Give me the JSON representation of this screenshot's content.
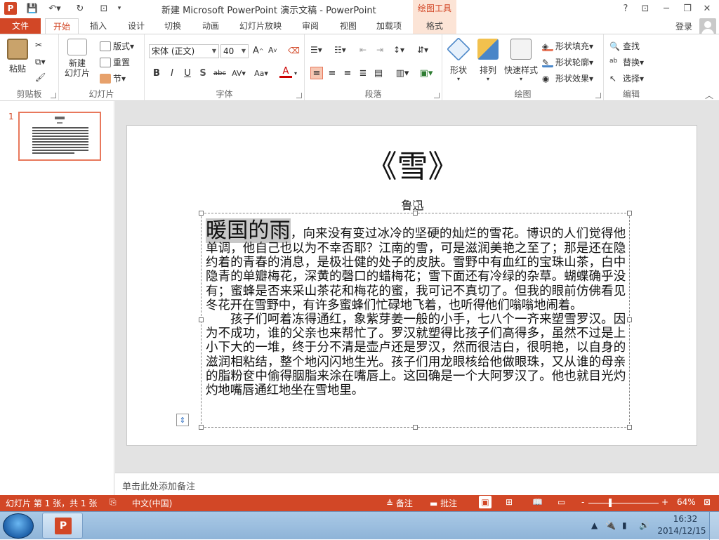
{
  "title_bar": {
    "window_title": "新建 Microsoft PowerPoint 演示文稿 - PowerPoint",
    "app_logo": "P",
    "contextual_tab_group": "绘图工具",
    "help": "?"
  },
  "tabs": {
    "file": "文件",
    "items": [
      "开始",
      "插入",
      "设计",
      "切换",
      "动画",
      "幻灯片放映",
      "审阅",
      "视图",
      "加载项",
      "格式"
    ],
    "active": "开始",
    "login": "登录"
  },
  "ribbon": {
    "clipboard": {
      "label": "剪贴板",
      "paste": "粘贴"
    },
    "slides": {
      "label": "幻灯片",
      "new_slide": "新建",
      "new_slide_2": "幻灯片",
      "layout": "版式",
      "reset": "重置",
      "section": "节"
    },
    "font": {
      "label": "字体",
      "font_name": "宋体 (正文)",
      "font_size": "40"
    },
    "paragraph": {
      "label": "段落"
    },
    "drawing": {
      "label": "绘图",
      "shapes": "形状",
      "arrange": "排列",
      "quick_styles": "快速样式",
      "shape_fill": "形状填充",
      "shape_outline": "形状轮廓",
      "shape_effects": "形状效果"
    },
    "editing": {
      "label": "编辑",
      "find": "查找",
      "replace": "替换",
      "select": "选择"
    }
  },
  "thumbnail": {
    "number": "1"
  },
  "slide": {
    "title": "《雪》",
    "subtitle": "鲁迅",
    "selected_text": "暖国的雨",
    "para1_rest": "，向来没有变过冰冷的坚硬的灿烂的雪花。博识的人们觉得他单调，他自己也以为不幸否耶？江南的雪，可是滋润美艳之至了；那是还在隐约着的青春的消息，是极壮健的处子的皮肤。雪野中有血红的宝珠山茶，白中隐青的单瓣梅花，深黄的磬口的蜡梅花；雪下面还有冷绿的杂草。蝴蝶确乎没有；蜜蜂是否来采山茶花和梅花的蜜，我可记不真切了。但我的眼前仿佛看见冬花开在雪野中，有许多蜜蜂们忙碌地飞着，也听得他们嗡嗡地闹着。",
    "para2": "孩子们呵着冻得通红，象紫芽姜一般的小手，七八个一齐来塑雪罗汉。因为不成功，谁的父亲也来帮忙了。罗汉就塑得比孩子们高得多，虽然不过是上小下大的一堆，终于分不清是壶卢还是罗汉，然而很洁白，很明艳，以自身的滋润相粘结，整个地闪闪地生光。孩子们用龙眼核给他做眼珠，又从谁的母亲的脂粉奁中偷得胭脂来涂在嘴唇上。这回确是一个大阿罗汉了。他也就目光灼灼地嘴唇通红地坐在雪地里。"
  },
  "notes": {
    "placeholder": "单击此处添加备注"
  },
  "status_bar": {
    "slide_info": "幻灯片 第 1 张，共 1 张",
    "language": "中文(中国)",
    "notes_btn": "备注",
    "comments_btn": "批注",
    "zoom_minus": "-",
    "zoom_plus": "+",
    "zoom": "64%",
    "zoom_level": 0.64
  },
  "taskbar": {
    "time": "16:32",
    "date": "2014/12/15"
  },
  "colors": {
    "accent": "#d24726",
    "contextual": "#fce4d6",
    "thumb_border": "#e8785c"
  }
}
